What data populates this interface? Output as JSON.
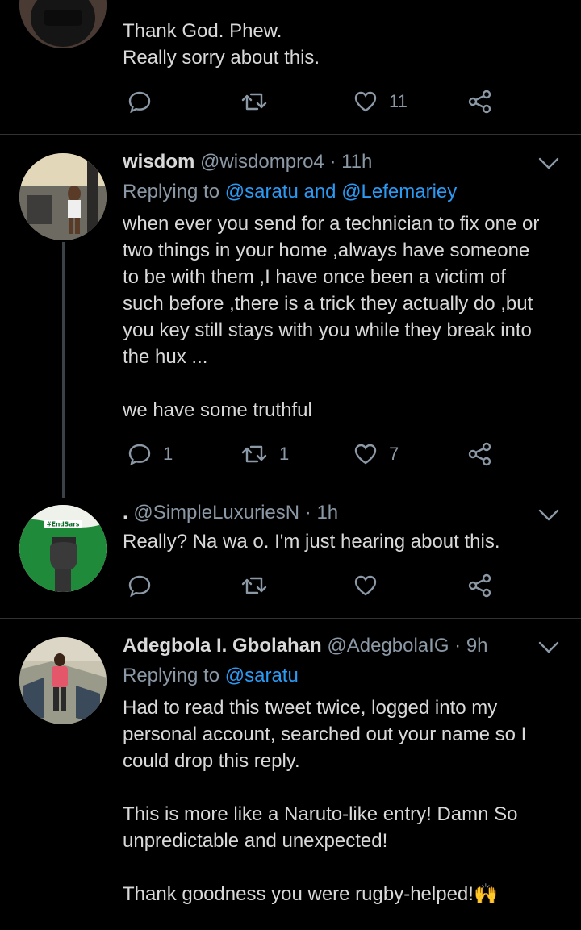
{
  "tweets": [
    {
      "lines": [
        "Thank God. Phew.",
        "Really sorry about this."
      ],
      "actions": {
        "reply": "",
        "retweet": "",
        "like": "11"
      }
    },
    {
      "name": "wisdom",
      "handle": "@wisdompro4",
      "time": "· 11h",
      "replying_prefix": "Replying to ",
      "replying_to": "@saratu and @Lefemariey",
      "lines": [
        "when ever you send for a technician to fix one or",
        "two things in your home ,always have someone",
        "to be with them ,I have once been a victim of",
        "such before ,there is a trick they actually do ,but",
        "you key still stays with you while they break into",
        "the hux ...",
        "",
        "we have some truthful"
      ],
      "actions": {
        "reply": "1",
        "retweet": "1",
        "like": "7"
      }
    },
    {
      "name": ".",
      "handle": "@SimpleLuxuriesN",
      "time": "· 1h",
      "lines": [
        "Really? Na wa o. I'm just hearing about this."
      ],
      "avatar_text": "#EndSars",
      "actions": {
        "reply": "",
        "retweet": "",
        "like": ""
      }
    },
    {
      "name": "Adegbola I. Gbolahan",
      "handle": "@AdegbolaIG",
      "time": "· 9h",
      "replying_prefix": "Replying to ",
      "replying_to": "@saratu",
      "lines": [
        "Had to read this tweet twice, logged into my",
        "personal account, searched out your name so I",
        "could drop this reply.",
        "",
        "This is more like a Naruto-like entry! Damn So",
        "unpredictable and unexpected!",
        "",
        "Thank goodness you were rugby-helped!🙌"
      ]
    }
  ],
  "colors": {
    "link": "#2b9af3",
    "muted": "#8b98a5",
    "text": "#d9d9d9",
    "separator": "#2f3336"
  }
}
